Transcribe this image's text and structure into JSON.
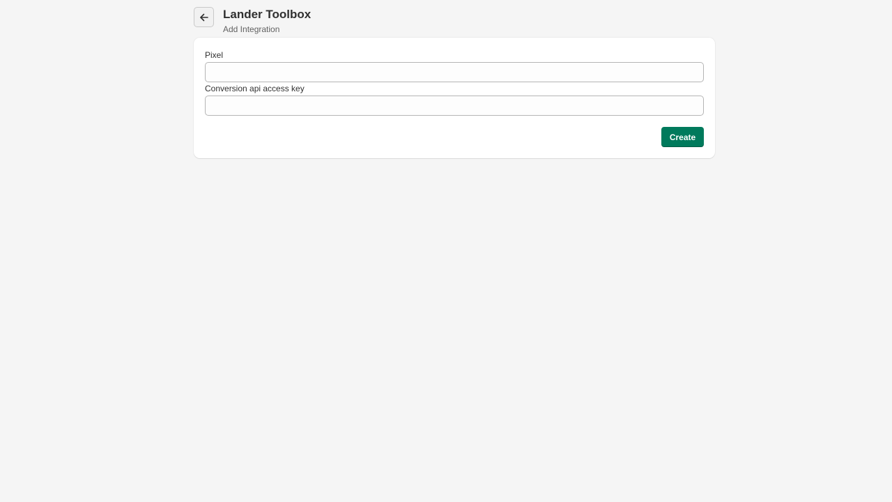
{
  "header": {
    "title": "Lander Toolbox",
    "subtitle": "Add Integration",
    "back_icon": "arrow-left-icon"
  },
  "form": {
    "fields": [
      {
        "label": "Pixel",
        "value": "",
        "placeholder": ""
      },
      {
        "label": "Conversion api access key",
        "value": "",
        "placeholder": ""
      }
    ],
    "submit_label": "Create"
  },
  "colors": {
    "background": "#f5f5f5",
    "card": "#ffffff",
    "primary_button": "#007a5c"
  }
}
